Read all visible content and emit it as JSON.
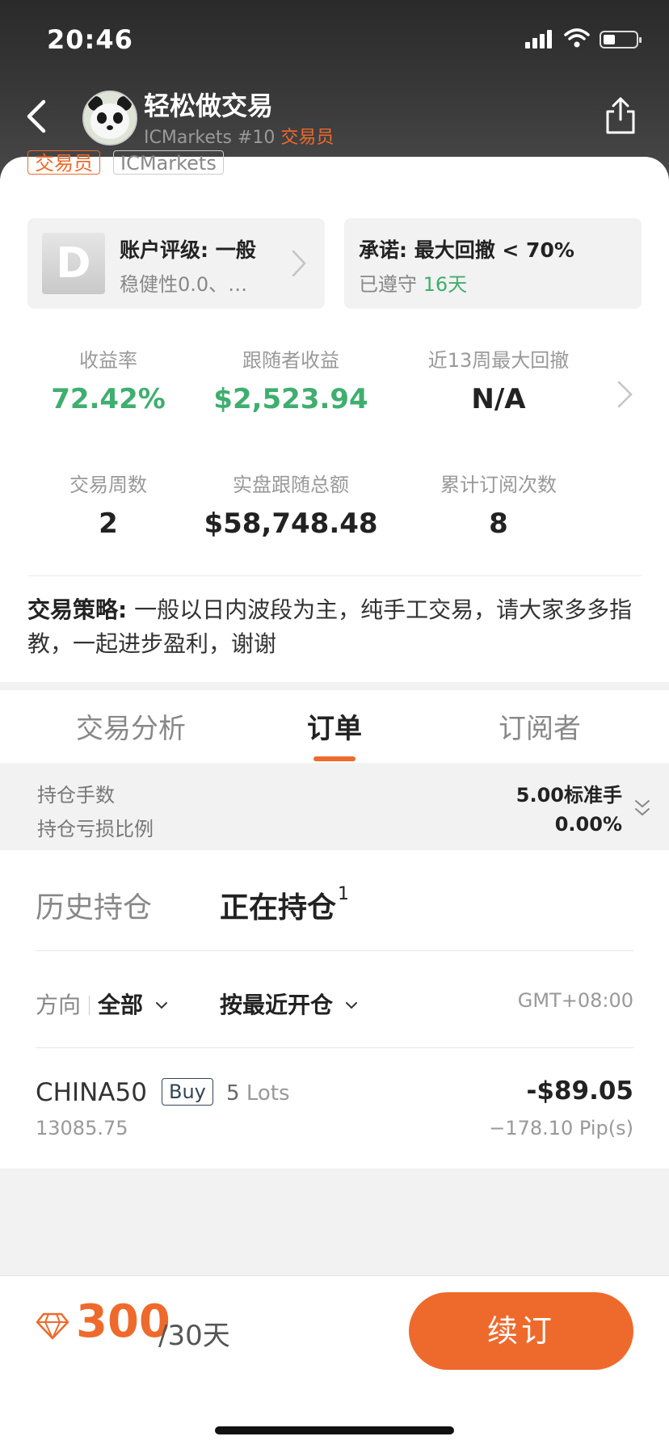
{
  "status_bar": {
    "time": "20:46"
  },
  "header": {
    "trader_name": "轻松做交易",
    "broker_rank": "ICMarkets #10",
    "role": "交易员"
  },
  "tags": {
    "role": "交易员",
    "broker": "ICMarkets"
  },
  "rating": {
    "grade": "D",
    "title": "账户评级: 一般",
    "subtitle": "稳健性0.0、…"
  },
  "promise": {
    "title": "承诺: 最大回撤 < 70%",
    "kept_prefix": "已遵守",
    "kept_days": "16天"
  },
  "stats": {
    "return_label": "收益率",
    "return_value": "72.42%",
    "follower_profit_label": "跟随者收益",
    "follower_profit_value": "$2,523.94",
    "max_drawdown_label": "近13周最大回撤",
    "max_drawdown_value": "N/A",
    "weeks_label": "交易周数",
    "weeks_value": "2",
    "follow_total_label": "实盘跟随总额",
    "follow_total_value": "$58,748.48",
    "subs_label": "累计订阅次数",
    "subs_value": "8"
  },
  "strategy": {
    "label": "交易策略:",
    "text": " 一般以日内波段为主，纯手工交易，请大家多多指教，一起进步盈利，谢谢"
  },
  "tabs": {
    "analysis": "交易分析",
    "orders": "订单",
    "subscribers": "订阅者"
  },
  "summary": {
    "lots_label": "持仓手数",
    "lots_value": "5.00标准手",
    "loss_ratio_label": "持仓亏损比例",
    "loss_ratio_value": "0.00%"
  },
  "orders": {
    "history_tab": "历史持仓",
    "open_tab": "正在持仓",
    "open_count": "1",
    "direction_label": "方向",
    "direction_value": "全部",
    "sort_label": "按最近开仓",
    "timezone": "GMT+08:00",
    "items": [
      {
        "symbol": "CHINA50",
        "side": "Buy",
        "lots_num": "5",
        "lots_unit": "Lots",
        "open_price": "13085.75",
        "pnl": "-$89.05",
        "pips": "−178.10 Pip(s)"
      }
    ]
  },
  "subscription": {
    "price": "300",
    "period": "/30天",
    "renew_label": "续订"
  },
  "colors": {
    "accent": "#ee6a2c",
    "positive": "#3fae6f"
  }
}
